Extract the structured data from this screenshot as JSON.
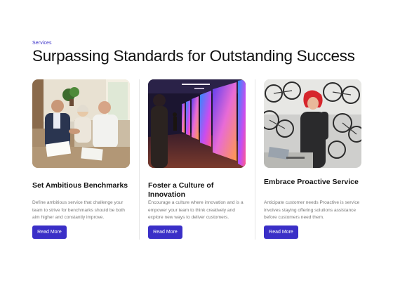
{
  "section": {
    "eyebrow": "Services",
    "title": "Surpassing Standards for Outstanding Success"
  },
  "cards": [
    {
      "title": "Set Ambitious Benchmarks",
      "description": "Define ambitious service that challenge your team to strive for benchmarks should be both aim higher and constantly improve.",
      "button_label": "Read More",
      "image": "family-handshake-photo"
    },
    {
      "title": "Foster a Culture of Innovation",
      "description": "Encourage a culture where innovation and is a empower your team to think creatively and explore new ways to deliver customers.",
      "button_label": "Read More",
      "image": "neon-gallery-photo"
    },
    {
      "title": "Embrace Proactive Service",
      "description": "Anticipate customer needs Proactive is service involves staying offering solutions assistance before customers need them.",
      "button_label": "Read More",
      "image": "bicycle-shop-photo"
    }
  ],
  "colors": {
    "accent": "#3a2fc7",
    "eyebrow": "#3a31c8",
    "muted_text": "#777777"
  }
}
